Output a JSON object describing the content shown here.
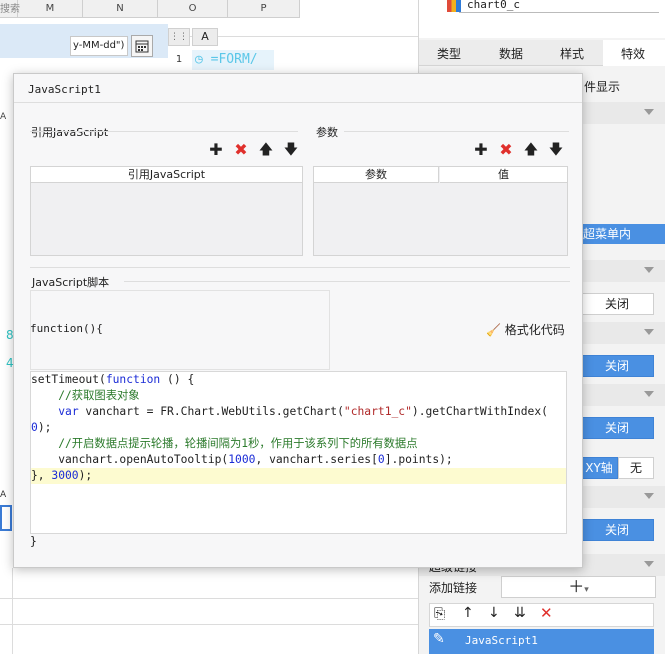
{
  "background": {
    "search_hint": "搜索",
    "col_headers": [
      "M",
      "N",
      "O",
      "P"
    ],
    "date_format": "y-MM-dd\")",
    "sheet_col_header": "A",
    "sheet_row": "1",
    "formula_text": "=FORM/",
    "left_cell_a": "A",
    "num_8": "8",
    "num_4": "4",
    "bottom_a": "A"
  },
  "right_panel": {
    "chart_name": "chart0_c",
    "tabs": [
      "类型",
      "数据",
      "样式",
      "特效"
    ],
    "active_tab": "特效",
    "condition_label": "件显示",
    "menu_in_label": "超菜单内",
    "close_label": "关闭",
    "xy_label": "XY轴",
    "none_label": "无",
    "hyperlink_label": "超级链接",
    "add_link_label": "添加链接",
    "list_item": "JavaScript1"
  },
  "dialog": {
    "title": "JavaScript1",
    "ref_section": "引用JavaScript",
    "ref_col": "引用JavaScript",
    "param_section": "参数",
    "param_col1": "参数",
    "param_col2": "值",
    "script_section": "JavaScript脚本",
    "function_header": "function(){",
    "format_button": "格式化代码",
    "closing_brace": "}",
    "code_lines": [
      "setTimeout(function () {",
      "    //获取图表对象",
      "    var vanchart = FR.Chart.WebUtils.getChart(\"chart1_c\").getChartWithIndex(",
      "0);",
      "    //开启数据点提示轮播，轮播间隔为1秒，作用于该系列下的所有数据点",
      "    vanchart.openAutoTooltip(1000, vanchart.series[0].points);",
      "}, 3000);"
    ]
  },
  "colors": {
    "accent": "#4a90e2",
    "delete": "#e0302c",
    "highlight_line": "#fdfbd0"
  }
}
